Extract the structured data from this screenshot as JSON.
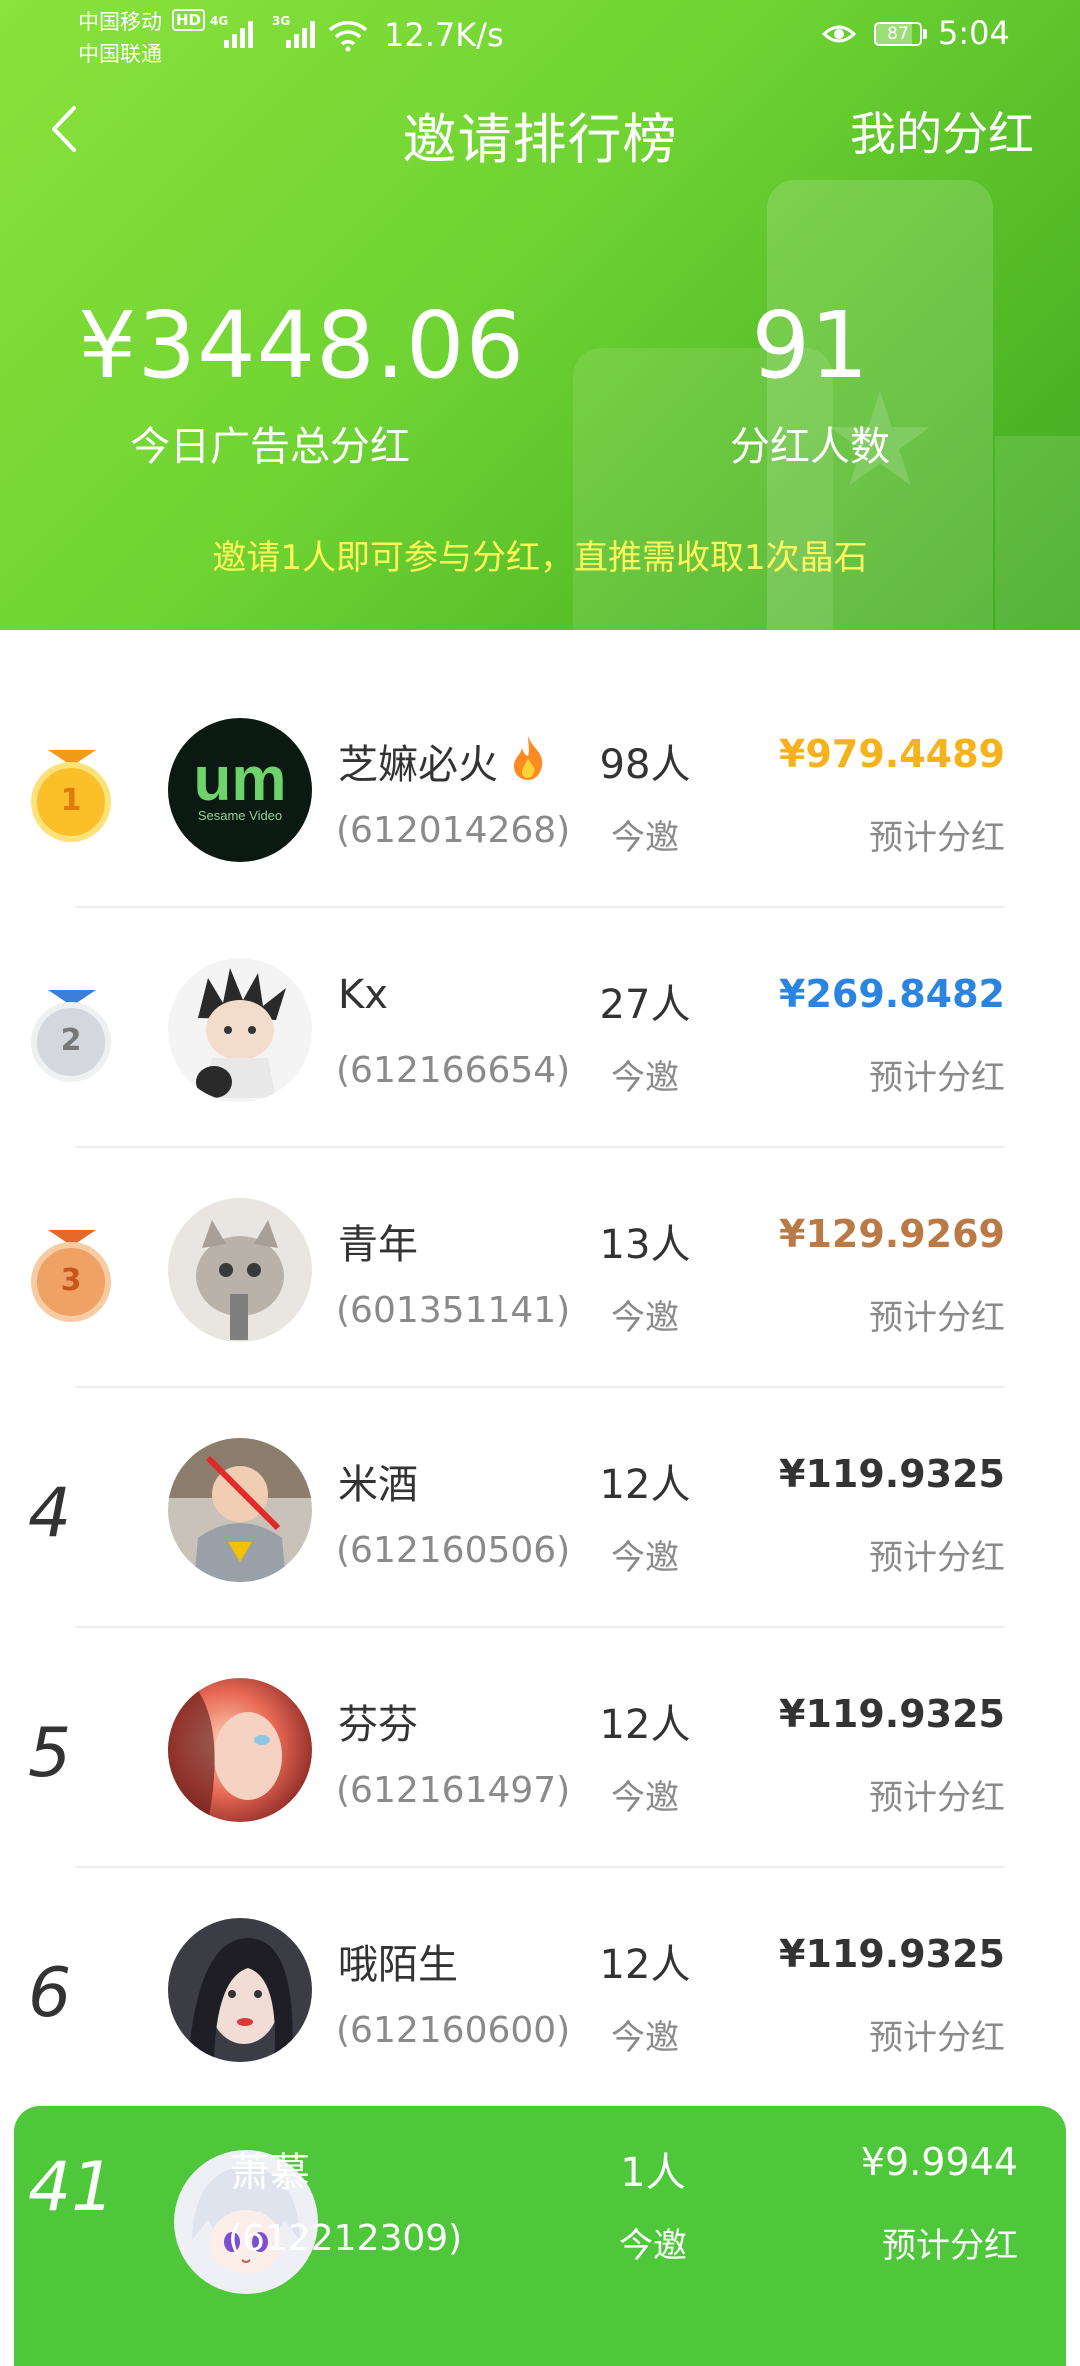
{
  "status_bar": {
    "carrier_1": "中国移动",
    "carrier_2": "中国联通",
    "hd": "HD",
    "net_1": "4G",
    "net_2": "3G",
    "speed": "12.7K/s",
    "battery": "87",
    "time": "5:04"
  },
  "header": {
    "title": "邀请排行榜",
    "right_action": "我的分红",
    "total_amount": "¥3448.06",
    "total_label": "今日广告总分红",
    "count_value": "91",
    "count_label": "分红人数",
    "notice": "邀请1人即可参与分红，直推需收取1次晶石"
  },
  "colors": {
    "header_green": "#6fd333",
    "notice_yellow": "#fff65a",
    "gold": "#f5b21b",
    "silver_blue": "#2b84e0",
    "bronze": "#b97a45",
    "card_green": "#4ec73a"
  },
  "ranking": {
    "invite_label": "今邀",
    "dividend_label": "预计分红",
    "rows": [
      {
        "rank": "1",
        "name": "芝嫲必火",
        "uid": "(612014268)",
        "invited": "98人",
        "amount": "¥979.4489",
        "avatar_text": "Sesame Video"
      },
      {
        "rank": "2",
        "name": "Kx",
        "uid": "(612166654)",
        "invited": "27人",
        "amount": "¥269.8482"
      },
      {
        "rank": "3",
        "name": "青年",
        "uid": "(601351141)",
        "invited": "13人",
        "amount": "¥129.9269"
      },
      {
        "rank": "4",
        "name": "米酒",
        "uid": "(612160506)",
        "invited": "12人",
        "amount": "¥119.9325"
      },
      {
        "rank": "5",
        "name": "芬芬",
        "uid": "(612161497)",
        "invited": "12人",
        "amount": "¥119.9325"
      },
      {
        "rank": "6",
        "name": "哦陌生",
        "uid": "(612160600)",
        "invited": "12人",
        "amount": "¥119.9325"
      }
    ]
  },
  "my_rank": {
    "rank": "41",
    "name": "萧慕",
    "uid": "(612212309)",
    "invited": "1人",
    "invited_label": "今邀",
    "amount": "¥9.9944",
    "amount_label": "预计分红"
  },
  "icons": [
    "back-icon",
    "wifi-icon",
    "eye-icon",
    "battery-icon",
    "fire-icon",
    "gold-medal-icon",
    "silver-medal-icon",
    "bronze-medal-icon"
  ]
}
